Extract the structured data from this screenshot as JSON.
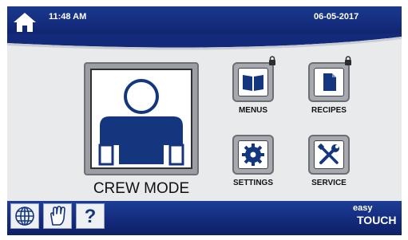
{
  "status_bar": {
    "time": "11:48 AM",
    "date": "06-05-2017"
  },
  "main": {
    "crew_mode_label": "CREW MODE",
    "tiles": [
      {
        "label": "MENUS",
        "icon": "book-icon",
        "locked": true
      },
      {
        "label": "RECIPES",
        "icon": "document-icon",
        "locked": true
      },
      {
        "label": "SETTINGS",
        "icon": "gear-icon",
        "locked": false
      },
      {
        "label": "SERVICE",
        "icon": "wrench-screwdriver-icon",
        "locked": false
      }
    ]
  },
  "bottom_bar": {
    "help_label": "?",
    "brand": {
      "line1": "easy",
      "line2": "TOUCH"
    }
  },
  "colors": {
    "bar_blue": "#13297a",
    "icon_blue": "#14367f",
    "panel_grey": "#e9eaec"
  }
}
